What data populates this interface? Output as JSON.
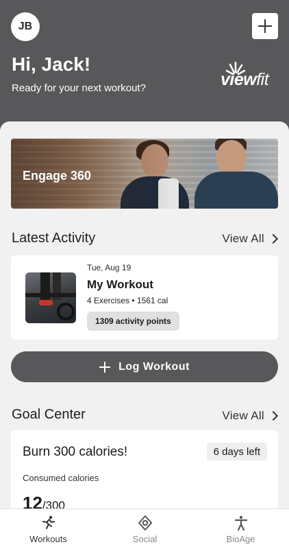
{
  "header": {
    "avatar_initials": "JB",
    "greeting": "Hi, Jack!",
    "subgreeting": "Ready for your next workout?",
    "logo": {
      "main": "view",
      "accent": "fit"
    }
  },
  "banner": {
    "title": "Engage 360"
  },
  "latest_activity": {
    "title": "Latest Activity",
    "view_all": "View All",
    "item": {
      "date": "Tue, Aug 19",
      "title": "My Workout",
      "meta": "4 Exercises • 1561 cal",
      "points": "1309 activity points"
    }
  },
  "log_button": {
    "label": "Log Workout"
  },
  "goal_center": {
    "title": "Goal Center",
    "view_all": "View All",
    "goal": {
      "title": "Burn 300 calories!",
      "days_left": "6 days left",
      "label": "Consumed calories",
      "value": "12",
      "target": "/300"
    }
  },
  "tabs": [
    {
      "label": "Workouts",
      "icon": "running-icon"
    },
    {
      "label": "Social",
      "icon": "social-icon"
    },
    {
      "label": "BioAge",
      "icon": "person-icon"
    }
  ],
  "colors": {
    "header": "#58585a",
    "background": "#f1f1f1",
    "accent": "#ffffff"
  }
}
